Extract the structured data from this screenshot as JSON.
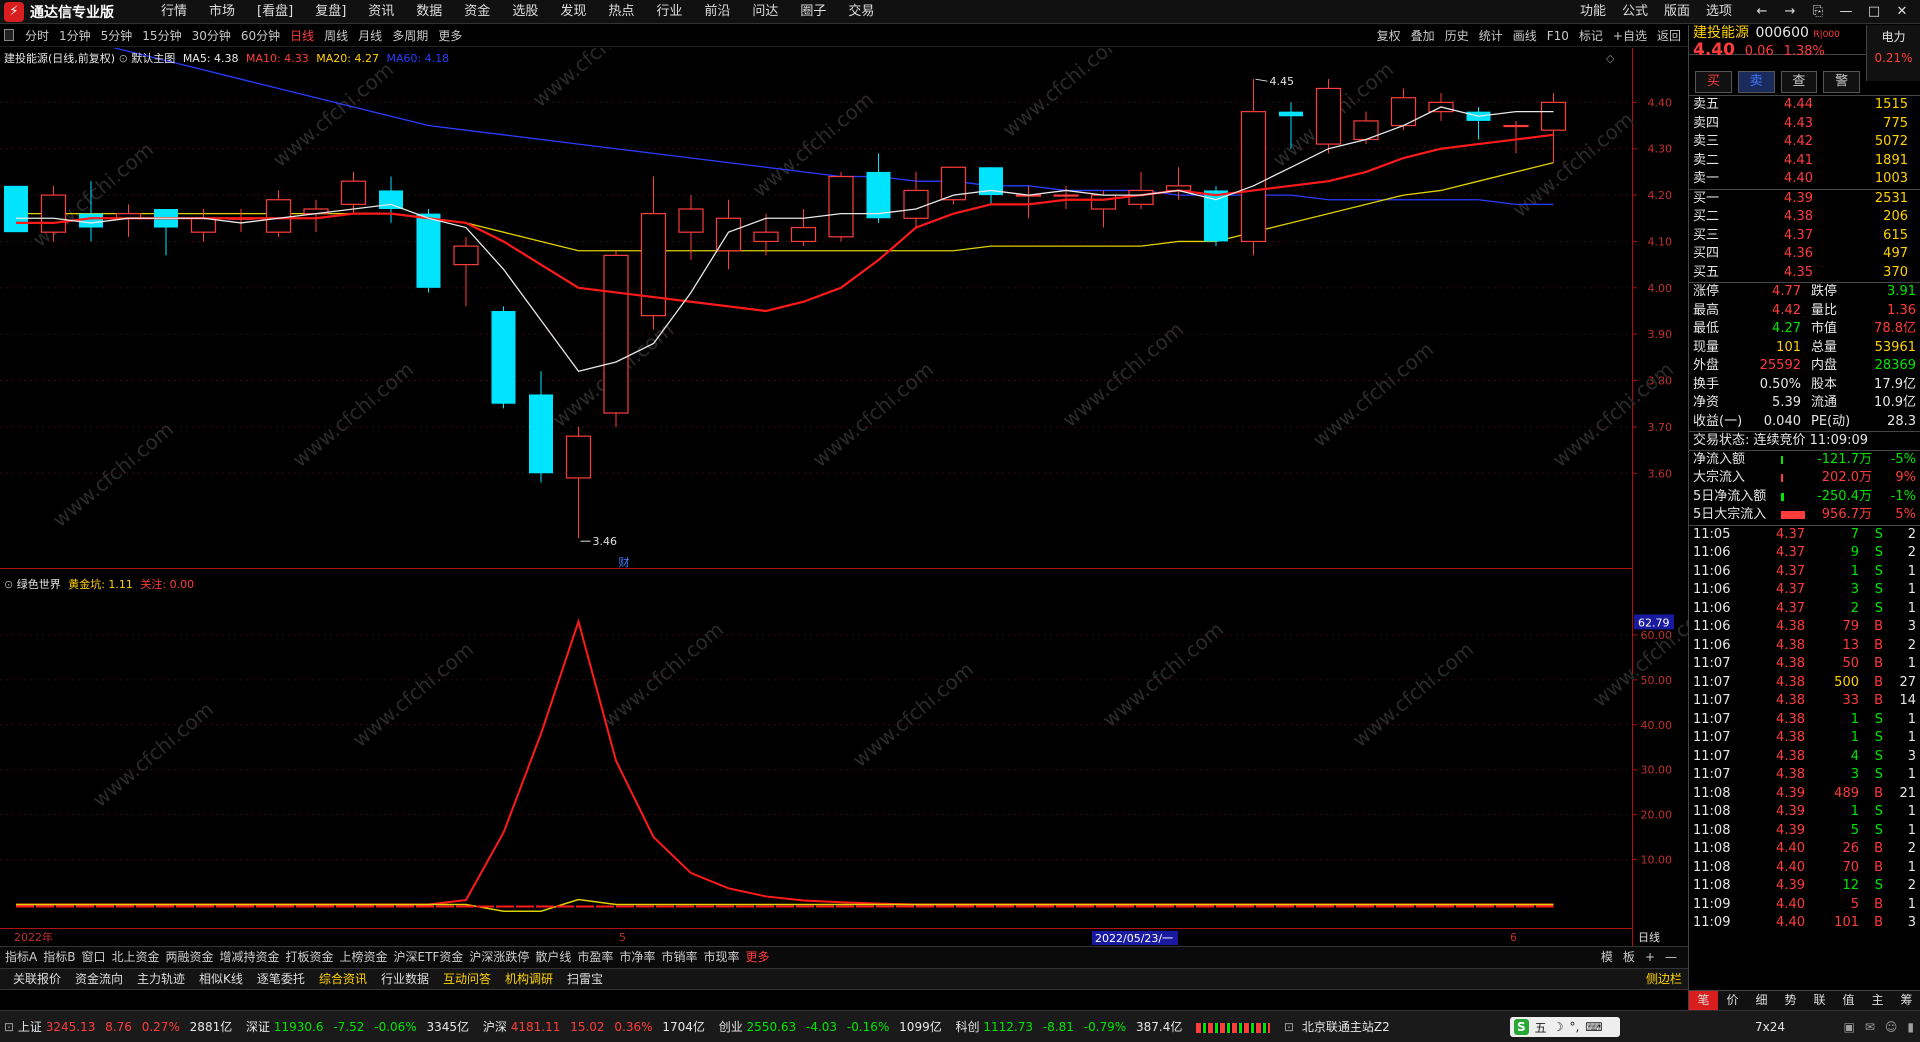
{
  "app": {
    "title": "通达信专业版"
  },
  "menu": [
    "行情",
    "市场",
    "[看盘]",
    "复盘]",
    "资讯",
    "数据",
    "资金",
    "选股",
    "发现",
    "热点",
    "行业",
    "前沿",
    "问达",
    "圈子",
    "交易"
  ],
  "menu_right": [
    "功能",
    "公式",
    "版面",
    "选项"
  ],
  "window_controls": [
    "←",
    "→",
    "⎘",
    "—",
    "□",
    "✕"
  ],
  "periods": [
    "分时",
    "1分钟",
    "5分钟",
    "15分钟",
    "30分钟",
    "60分钟",
    "日线",
    "周线",
    "月线",
    "多周期",
    "更多"
  ],
  "active_period": "日线",
  "tools": [
    "复权",
    "叠加",
    "历史",
    "统计",
    "画线",
    "F10",
    "标记",
    "+自选",
    "返回"
  ],
  "main_legend": {
    "name": "建投能源(日线,前复权)",
    "template": "默认主图",
    "ma5": "MA5: 4.38",
    "ma10": "MA10: 4.33",
    "ma20": "MA20: 4.27",
    "ma60": "MA60: 4.18"
  },
  "sub_legend": {
    "name": "绿色世界",
    "gold": "黄金坑: 1.11",
    "attention": "关注: 0.00"
  },
  "price_axis": [
    "4.40",
    "4.30",
    "4.20",
    "4.10",
    "4.00",
    "3.90",
    "3.80",
    "3.70",
    "3.60"
  ],
  "sub_axis": [
    "60.00",
    "50.00",
    "40.00",
    "30.00",
    "20.00",
    "10.00"
  ],
  "sub_current": "62.79",
  "high_label": "4.45",
  "low_label": "3.46",
  "fin_marker": "财",
  "date_labels": {
    "year": "2022年",
    "m5": "5",
    "cursor": "2022/05/23/一",
    "m6": "6",
    "period": "日线"
  },
  "candles": [
    {
      "o": 4.22,
      "c": 4.12,
      "h": 4.22,
      "l": 4.12
    },
    {
      "o": 4.12,
      "c": 4.2,
      "h": 4.22,
      "l": 4.1
    },
    {
      "o": 4.16,
      "c": 4.13,
      "h": 4.23,
      "l": 4.1
    },
    {
      "o": 4.15,
      "c": 4.16,
      "h": 4.18,
      "l": 4.11
    },
    {
      "o": 4.17,
      "c": 4.13,
      "h": 4.17,
      "l": 4.07
    },
    {
      "o": 4.12,
      "c": 4.15,
      "h": 4.17,
      "l": 4.1
    },
    {
      "o": 4.15,
      "c": 4.15,
      "h": 4.17,
      "l": 4.12
    },
    {
      "o": 4.12,
      "c": 4.19,
      "h": 4.21,
      "l": 4.11
    },
    {
      "o": 4.16,
      "c": 4.17,
      "h": 4.19,
      "l": 4.12
    },
    {
      "o": 4.18,
      "c": 4.23,
      "h": 4.25,
      "l": 4.16
    },
    {
      "o": 4.21,
      "c": 4.17,
      "h": 4.24,
      "l": 4.14
    },
    {
      "o": 4.16,
      "c": 4.0,
      "h": 4.17,
      "l": 3.99
    },
    {
      "o": 4.05,
      "c": 4.09,
      "h": 4.11,
      "l": 3.96
    },
    {
      "o": 3.95,
      "c": 3.75,
      "h": 3.96,
      "l": 3.74
    },
    {
      "o": 3.77,
      "c": 3.6,
      "h": 3.82,
      "l": 3.58
    },
    {
      "o": 3.59,
      "c": 3.68,
      "h": 3.7,
      "l": 3.46
    },
    {
      "o": 3.73,
      "c": 4.07,
      "h": 4.08,
      "l": 3.7
    },
    {
      "o": 3.94,
      "c": 4.16,
      "h": 4.24,
      "l": 3.91
    },
    {
      "o": 4.12,
      "c": 4.17,
      "h": 4.2,
      "l": 4.06
    },
    {
      "o": 4.08,
      "c": 4.15,
      "h": 4.19,
      "l": 4.04
    },
    {
      "o": 4.1,
      "c": 4.12,
      "h": 4.16,
      "l": 4.07
    },
    {
      "o": 4.1,
      "c": 4.13,
      "h": 4.17,
      "l": 4.09
    },
    {
      "o": 4.11,
      "c": 4.24,
      "h": 4.25,
      "l": 4.1
    },
    {
      "o": 4.25,
      "c": 4.15,
      "h": 4.29,
      "l": 4.14
    },
    {
      "o": 4.15,
      "c": 4.21,
      "h": 4.25,
      "l": 4.13
    },
    {
      "o": 4.19,
      "c": 4.26,
      "h": 4.26,
      "l": 4.18
    },
    {
      "o": 4.26,
      "c": 4.2,
      "h": 4.26,
      "l": 4.18
    },
    {
      "o": 4.2,
      "c": 4.2,
      "h": 4.22,
      "l": 4.15
    },
    {
      "o": 4.2,
      "c": 4.2,
      "h": 4.22,
      "l": 4.17
    },
    {
      "o": 4.17,
      "c": 4.2,
      "h": 4.21,
      "l": 4.13
    },
    {
      "o": 4.18,
      "c": 4.21,
      "h": 4.25,
      "l": 4.17
    },
    {
      "o": 4.21,
      "c": 4.22,
      "h": 4.26,
      "l": 4.19
    },
    {
      "o": 4.21,
      "c": 4.1,
      "h": 4.22,
      "l": 4.09
    },
    {
      "o": 4.1,
      "c": 4.38,
      "h": 4.45,
      "l": 4.07
    },
    {
      "o": 4.38,
      "c": 4.37,
      "h": 4.4,
      "l": 4.3
    },
    {
      "o": 4.31,
      "c": 4.43,
      "h": 4.45,
      "l": 4.29
    },
    {
      "o": 4.32,
      "c": 4.36,
      "h": 4.38,
      "l": 4.31
    },
    {
      "o": 4.35,
      "c": 4.41,
      "h": 4.43,
      "l": 4.34
    },
    {
      "o": 4.38,
      "c": 4.4,
      "h": 4.42,
      "l": 4.36
    },
    {
      "o": 4.38,
      "c": 4.36,
      "h": 4.39,
      "l": 4.32
    },
    {
      "o": 4.35,
      "c": 4.35,
      "h": 4.36,
      "l": 4.29
    },
    {
      "o": 4.34,
      "c": 4.4,
      "h": 4.42,
      "l": 4.27
    }
  ],
  "ma5": [
    4.15,
    4.15,
    4.14,
    4.15,
    4.15,
    4.15,
    4.14,
    4.15,
    4.16,
    4.17,
    4.18,
    4.15,
    4.13,
    4.04,
    3.93,
    3.82,
    3.84,
    3.88,
    3.99,
    4.12,
    4.15,
    4.15,
    4.16,
    4.16,
    4.17,
    4.2,
    4.21,
    4.2,
    4.21,
    4.2,
    4.2,
    4.21,
    4.19,
    4.22,
    4.26,
    4.3,
    4.32,
    4.35,
    4.39,
    4.37,
    4.38,
    4.38
  ],
  "ma10": [
    4.14,
    4.14,
    4.15,
    4.15,
    4.15,
    4.15,
    4.15,
    4.15,
    4.15,
    4.16,
    4.16,
    4.15,
    4.14,
    4.1,
    4.05,
    4.0,
    3.99,
    3.98,
    3.97,
    3.96,
    3.95,
    3.97,
    4.0,
    4.06,
    4.13,
    4.16,
    4.18,
    4.18,
    4.19,
    4.19,
    4.2,
    4.21,
    4.2,
    4.21,
    4.22,
    4.23,
    4.25,
    4.28,
    4.3,
    4.31,
    4.32,
    4.33
  ],
  "ma20": [
    4.16,
    4.16,
    4.16,
    4.16,
    4.16,
    4.16,
    4.16,
    4.16,
    4.16,
    4.16,
    4.16,
    4.15,
    4.14,
    4.12,
    4.1,
    4.08,
    4.08,
    4.08,
    4.08,
    4.08,
    4.08,
    4.08,
    4.08,
    4.08,
    4.08,
    4.08,
    4.09,
    4.09,
    4.09,
    4.09,
    4.09,
    4.1,
    4.1,
    4.12,
    4.14,
    4.16,
    4.18,
    4.2,
    4.21,
    4.23,
    4.25,
    4.27
  ],
  "ma60": [
    4.57,
    4.55,
    4.53,
    4.51,
    4.49,
    4.47,
    4.45,
    4.43,
    4.41,
    4.39,
    4.37,
    4.35,
    4.34,
    4.33,
    4.32,
    4.31,
    4.3,
    4.29,
    4.28,
    4.27,
    4.26,
    4.25,
    4.24,
    4.24,
    4.23,
    4.23,
    4.22,
    4.22,
    4.21,
    4.21,
    4.21,
    4.2,
    4.2,
    4.2,
    4.2,
    4.19,
    4.19,
    4.19,
    4.19,
    4.19,
    4.18,
    4.18
  ],
  "sub_red": [
    0,
    0,
    0,
    0,
    0,
    0,
    0,
    0,
    0,
    0,
    0,
    0,
    1.0,
    16,
    38,
    63,
    32,
    15,
    7,
    3.6,
    1.8,
    0.9,
    0.5,
    0.2,
    0,
    0,
    0,
    0,
    0,
    0,
    0,
    0,
    0,
    0,
    0,
    0,
    0,
    0,
    0,
    0,
    0,
    0
  ],
  "sub_yellow": [
    0,
    0,
    0,
    0,
    0,
    0,
    0,
    0,
    0,
    0,
    0,
    0,
    0,
    -1.5,
    -1.5,
    1.11,
    0,
    0,
    0,
    0,
    0,
    0,
    0,
    0,
    0,
    0,
    0,
    0,
    0,
    0,
    0,
    0,
    0,
    0,
    0,
    0,
    0,
    0,
    0,
    0,
    0,
    0
  ],
  "watermark": "www.cfchi.com",
  "bottom_tabs": [
    "指标A",
    "指标B",
    "窗口",
    "北上资金",
    "两融资金",
    "增减持资金",
    "打板资金",
    "上榜资金",
    "沪深ETF资金",
    "沪深涨跌停",
    "散户线",
    "市盈率",
    "市净率",
    "市销率",
    "市现率",
    "更多"
  ],
  "bottom_right": [
    "模",
    "板",
    "+",
    "—"
  ],
  "func_tabs": [
    "关联报价",
    "资金流向",
    "主力轨迹",
    "相似K线",
    "逐笔委托",
    "综合资讯",
    "行业数据",
    "互动问答",
    "机构调研",
    "扫雷宝"
  ],
  "func_right": "侧边栏",
  "stock": {
    "name": "建投能源",
    "code": "000600",
    "badge": "R|000",
    "sector": "电力",
    "sector_chg": "0.21%",
    "price": "4.40",
    "chg": "0.06",
    "pct": "1.38%"
  },
  "trade_buttons": [
    "买",
    "卖",
    "查",
    "警"
  ],
  "asks": [
    [
      "卖五",
      "4.44",
      "1515"
    ],
    [
      "卖四",
      "4.43",
      "775"
    ],
    [
      "卖三",
      "4.42",
      "5072"
    ],
    [
      "卖二",
      "4.41",
      "1891"
    ],
    [
      "卖一",
      "4.40",
      "1003"
    ]
  ],
  "bids": [
    [
      "买一",
      "4.39",
      "2531"
    ],
    [
      "买二",
      "4.38",
      "206"
    ],
    [
      "买三",
      "4.37",
      "615"
    ],
    [
      "买四",
      "4.36",
      "497"
    ],
    [
      "买五",
      "4.35",
      "370"
    ]
  ],
  "stats": [
    [
      "涨停",
      "4.77",
      "跌停",
      "3.91"
    ],
    [
      "最高",
      "4.42",
      "量比",
      "1.36"
    ],
    [
      "最低",
      "4.27",
      "市值",
      "78.8亿"
    ],
    [
      "现量",
      "101",
      "总量",
      "53961"
    ],
    [
      "外盘",
      "25592",
      "内盘",
      "28369"
    ],
    [
      "换手",
      "0.50%",
      "股本",
      "17.9亿"
    ],
    [
      "净资",
      "5.39",
      "流通",
      "10.9亿"
    ],
    [
      "收益(一)",
      "0.040",
      "PE(动)",
      "28.3"
    ]
  ],
  "trade_status": "交易状态: 连续竞价 11:09:09",
  "flows": [
    [
      "净流入额",
      "-121.7万",
      "-5%"
    ],
    [
      "大宗流入",
      "202.0万",
      "9%"
    ],
    [
      "5日净流入额",
      "-250.4万",
      "-1%"
    ],
    [
      "5日大宗流入",
      "956.7万",
      "5%"
    ]
  ],
  "flow_bars": [
    0.03,
    0.03,
    0.05,
    0.4
  ],
  "ticks": [
    [
      "11:05",
      "4.37",
      "7",
      "S",
      "2"
    ],
    [
      "11:06",
      "4.37",
      "9",
      "S",
      "2"
    ],
    [
      "11:06",
      "4.37",
      "1",
      "S",
      "1"
    ],
    [
      "11:06",
      "4.37",
      "3",
      "S",
      "1"
    ],
    [
      "11:06",
      "4.37",
      "2",
      "S",
      "1"
    ],
    [
      "11:06",
      "4.38",
      "79",
      "B",
      "3"
    ],
    [
      "11:06",
      "4.38",
      "13",
      "B",
      "2"
    ],
    [
      "11:07",
      "4.38",
      "50",
      "B",
      "1"
    ],
    [
      "11:07",
      "4.38",
      "500",
      "B",
      "27"
    ],
    [
      "11:07",
      "4.38",
      "33",
      "B",
      "14"
    ],
    [
      "11:07",
      "4.38",
      "1",
      "S",
      "1"
    ],
    [
      "11:07",
      "4.38",
      "1",
      "S",
      "1"
    ],
    [
      "11:07",
      "4.38",
      "4",
      "S",
      "3"
    ],
    [
      "11:07",
      "4.38",
      "3",
      "S",
      "1"
    ],
    [
      "11:08",
      "4.39",
      "489",
      "B",
      "21"
    ],
    [
      "11:08",
      "4.39",
      "1",
      "S",
      "1"
    ],
    [
      "11:08",
      "4.39",
      "5",
      "S",
      "1"
    ],
    [
      "11:08",
      "4.40",
      "26",
      "B",
      "2"
    ],
    [
      "11:08",
      "4.40",
      "70",
      "B",
      "1"
    ],
    [
      "11:08",
      "4.39",
      "12",
      "S",
      "2"
    ],
    [
      "11:09",
      "4.40",
      "5",
      "B",
      "1"
    ],
    [
      "11:09",
      "4.40",
      "101",
      "B",
      "3"
    ]
  ],
  "rp_tabs": [
    "笔",
    "价",
    "细",
    "势",
    "联",
    "值",
    "主",
    "筹"
  ],
  "status": {
    "sh_name": "上证",
    "sh_val": "3245.13",
    "sh_chg": "8.76",
    "sh_pct": "0.27%",
    "sh_amt": "2881亿",
    "sz_name": "深证",
    "sz_val": "11930.6",
    "sz_chg": "-7.52",
    "sz_pct": "-0.06%",
    "sz_amt": "3345亿",
    "hs_name": "沪深",
    "hs_val": "4181.11",
    "hs_chg": "15.02",
    "hs_pct": "0.36%",
    "hs_amt": "1704亿",
    "cy_name": "创业",
    "cy_val": "2550.63",
    "cy_chg": "-4.03",
    "cy_pct": "-0.16%",
    "cy_amt": "1099亿",
    "kc_name": "科创",
    "kc_val": "1112.73",
    "kc_chg": "-8.81",
    "kc_pct": "-0.79%",
    "kc_amt": "387.4亿",
    "station": "北京联通主站Z2",
    "clock": "7x24",
    "ime": "五"
  }
}
